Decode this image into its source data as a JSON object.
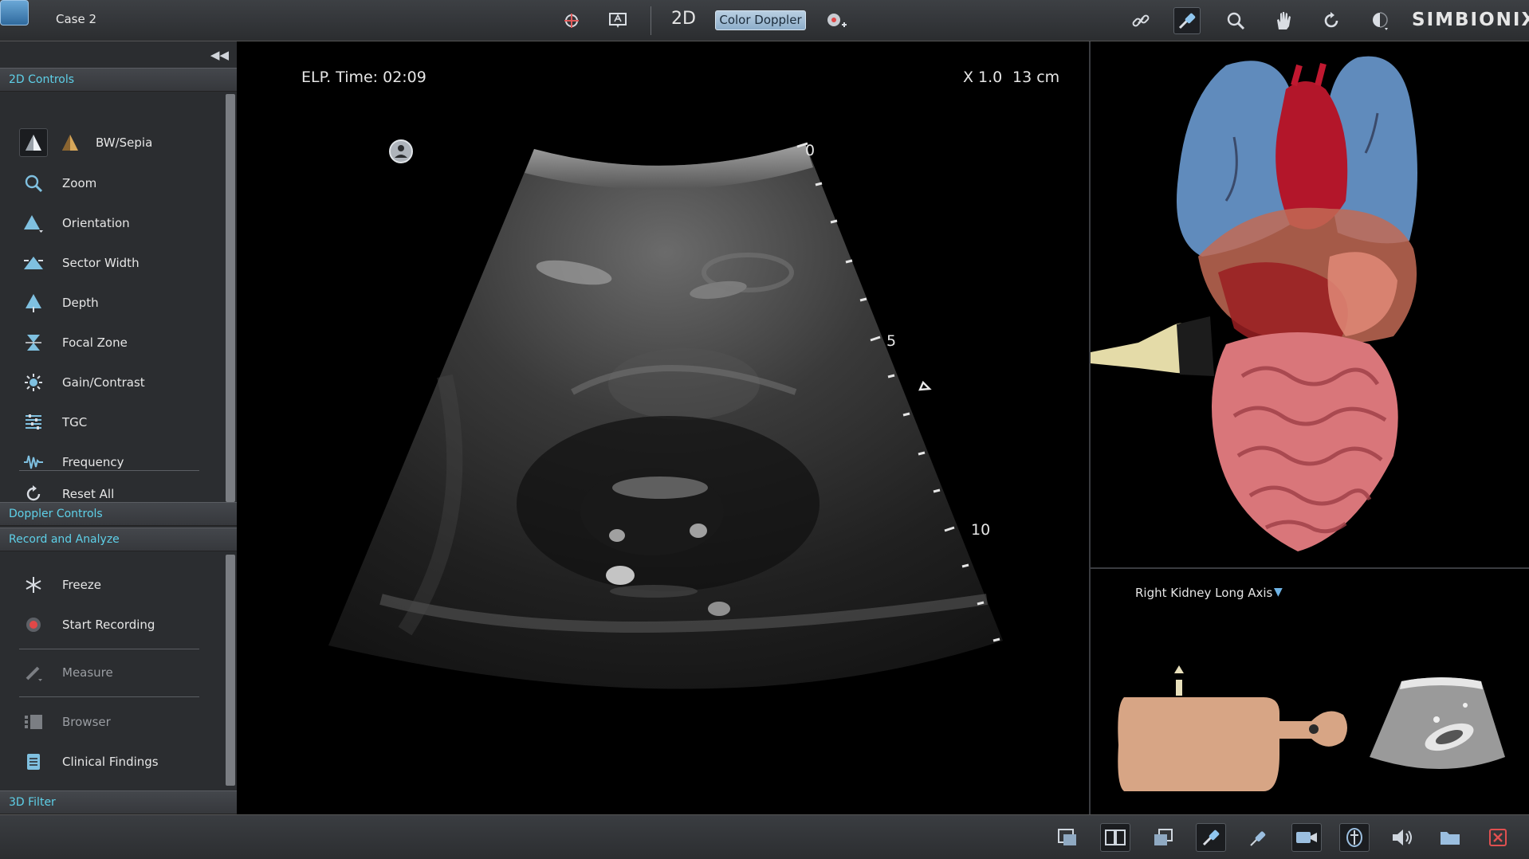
{
  "top_bar": {
    "case_title": "Case 2",
    "mode_2d": "2D",
    "color_doppler": "Color Doppler",
    "brand": "SIMBIONIX",
    "icons": [
      "app-icon",
      "multi-probe-icon",
      "annotation-icon",
      "mode-2d-icon",
      "color-doppler-button",
      "doppler-settings-icon",
      "link-icon",
      "probe-icon",
      "zoom-icon",
      "pan-icon",
      "rotate-icon",
      "transparency-icon"
    ]
  },
  "left_panel": {
    "section_2d": "2D Controls",
    "items_2d": [
      {
        "label": "BW/Sepia",
        "icon": "bw-sepia-icon"
      },
      {
        "label": "Zoom",
        "icon": "zoom-icon"
      },
      {
        "label": "Orientation",
        "icon": "orientation-icon"
      },
      {
        "label": "Sector Width",
        "icon": "sector-width-icon"
      },
      {
        "label": "Depth",
        "icon": "depth-icon"
      },
      {
        "label": "Focal Zone",
        "icon": "focal-zone-icon"
      },
      {
        "label": "Gain/Contrast",
        "icon": "gain-contrast-icon"
      },
      {
        "label": "TGC",
        "icon": "tgc-icon"
      },
      {
        "label": "Frequency",
        "icon": "frequency-icon"
      },
      {
        "label": "Reset All",
        "icon": "reset-icon"
      }
    ],
    "section_doppler": "Doppler Controls",
    "section_record": "Record and Analyze",
    "items_record": [
      {
        "label": "Freeze",
        "icon": "freeze-icon"
      },
      {
        "label": "Start Recording",
        "icon": "record-icon"
      },
      {
        "label": "Measure",
        "icon": "measure-icon"
      },
      {
        "label": "Browser",
        "icon": "browser-icon"
      },
      {
        "label": "Clinical Findings",
        "icon": "clinical-findings-icon"
      }
    ],
    "section_3d": "3D Filter"
  },
  "ultrasound": {
    "elp_time": "ELP. Time: 02:09",
    "zoom": "X 1.0",
    "depth": "13 cm",
    "scale_labels": [
      "0",
      "5",
      "10"
    ]
  },
  "reference_panel": {
    "view_name": "Right Kidney Long Axis"
  },
  "bottom_bar": {
    "icons": [
      "single-view-icon",
      "dual-view-icon",
      "overlay-view-icon",
      "probe-view-icon",
      "needle-icon",
      "camera-icon",
      "anatomy-icon",
      "volume-icon",
      "folder-icon",
      "close-icon"
    ]
  }
}
